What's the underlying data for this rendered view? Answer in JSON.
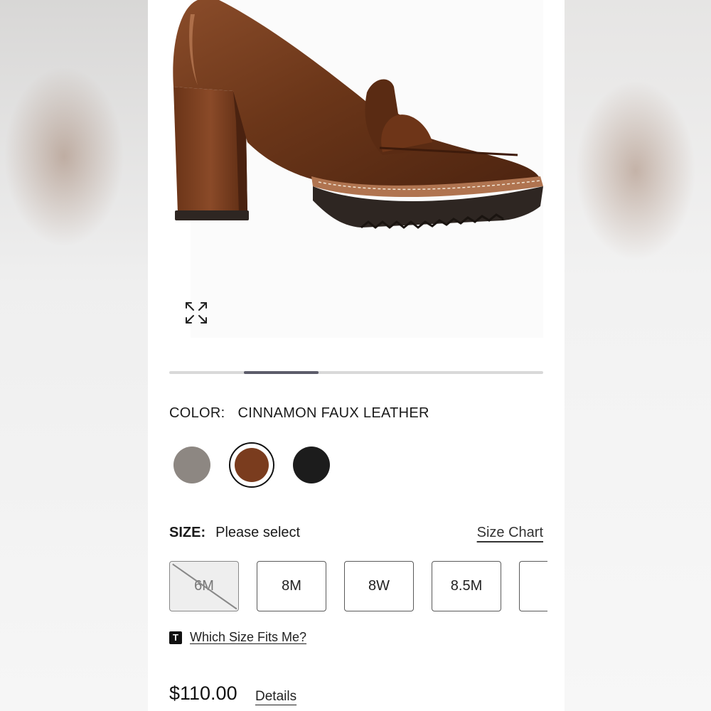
{
  "color": {
    "label": "COLOR:",
    "value": "CINNAMON FAUX LEATHER",
    "swatches": [
      {
        "name": "grey",
        "hex": "#8d8782"
      },
      {
        "name": "cinnamon",
        "hex": "#7a3c1e",
        "selected": true
      },
      {
        "name": "black",
        "hex": "#1c1c1c"
      }
    ]
  },
  "carousel": {
    "current": 2,
    "total": 5
  },
  "size": {
    "label": "SIZE:",
    "value": "Please select",
    "chart_link": "Size Chart",
    "options": [
      {
        "label": "6M",
        "available": false
      },
      {
        "label": "8M",
        "available": true
      },
      {
        "label": "8W",
        "available": true
      },
      {
        "label": "8.5M",
        "available": true
      }
    ]
  },
  "fit": {
    "icon_letter": "T",
    "link": "Which Size Fits Me?"
  },
  "price": {
    "amount": "$110.00",
    "details_link": "Details"
  },
  "colors": {
    "shoe": "#6b3619",
    "sole": "#2e2622",
    "accent": "#5c5c6a"
  }
}
